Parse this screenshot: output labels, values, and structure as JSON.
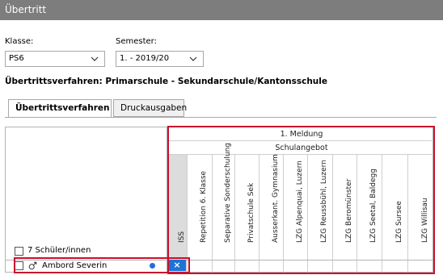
{
  "window": {
    "title": "Übertritt"
  },
  "filters": {
    "class_label": "Klasse:",
    "class_value": "PS6",
    "semester_label": "Semester:",
    "semester_value": "1. - 2019/20"
  },
  "procedure": {
    "text": "Übertrittsverfahren: Primarschule - Sekundarschule/Kantonsschule"
  },
  "tabs": [
    {
      "label": "Übertrittsverfahren",
      "active": true
    },
    {
      "label": "Druckausgaben",
      "active": false
    }
  ],
  "grid": {
    "header_row1": "1. Meldung",
    "header_row2": "Schulangebot",
    "columns": [
      "ISS",
      "Repetition 6. Klasse",
      "Separative Sonderschulung",
      "Privatschule Sek",
      "Ausserkant. Gymnasium",
      "LZG Alpenquai, Luzern",
      "LZG Reussbühl, Luzern",
      "LZG Beromünster",
      "LZG Seetal, Baldegg",
      "LZG Sursee",
      "LZG Willisau"
    ],
    "student_count_label": "7 Schüler/innen",
    "rows": [
      {
        "name": "Ambord Severin",
        "gender_icon": "male-icon",
        "mark": "×",
        "mark_column": "ISS"
      }
    ]
  },
  "colors": {
    "accent": "#1e73d6",
    "highlight": "#c8102e",
    "titlebar": "#7d7d7d"
  }
}
